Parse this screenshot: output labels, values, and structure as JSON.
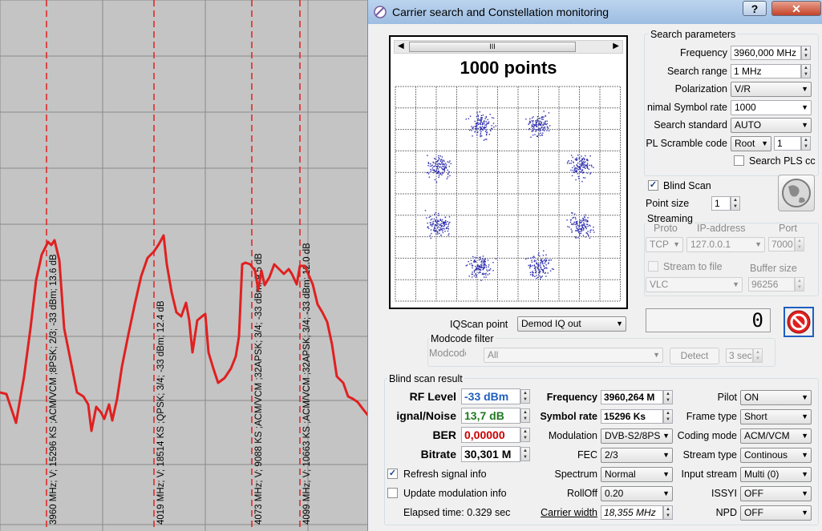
{
  "window": {
    "title": "Carrier search and Constellation monitoring",
    "help_label": "?",
    "close_label": "✕"
  },
  "spectrum": {
    "markers": [
      {
        "label": "3960 MHz; V; 15296 KS ;ACM/VCM ;8PSK; 2/3; -33 dBm; 13.6 dB"
      },
      {
        "label": "4019 MHz; V; 18514 KS ;QPSK; 3/4; -33 dBm; 12.4 dB"
      },
      {
        "label": "4073 MHz; V; 9088 KS ;ACM/VCM ;32APSK; 3/4; -33 dBm; 9.5 dB"
      },
      {
        "label": "4099 MHz; V; 10663 KS ;ACM/VCM ;32APSK; 3/4; -33 dBm; 12.0 dB"
      }
    ]
  },
  "constellation": {
    "title": "1000 points",
    "scroll_grip": "III",
    "point_count": 1000
  },
  "search": {
    "title": "Search parameters",
    "frequency_label": "Frequency",
    "frequency_value": "3960,000 MHz",
    "range_label": "Search range",
    "range_value": "1 MHz",
    "polarization_label": "Polarization",
    "polarization_value": "V/R",
    "min_sr_label": "nimal Symbol rate",
    "min_sr_value": "1000",
    "standard_label": "Search standard",
    "standard_value": "AUTO",
    "pls_label": "PL Scramble code",
    "pls_mode": "Root",
    "pls_value": "1",
    "search_pls_label": "Search PLS cc"
  },
  "blind_scan": {
    "label": "Blind Scan",
    "checked": "✓",
    "point_size_label": "Point size",
    "point_size_value": "1"
  },
  "streaming": {
    "title": "Streaming",
    "proto_label": "Proto",
    "ip_label": "IP-address",
    "port_label": "Port",
    "proto_value": "TCP",
    "ip_value": "127.0.0.1",
    "port_value": "7000",
    "stream_file_label": "Stream to file",
    "buffer_label": "Buffer size",
    "player_value": "VLC",
    "buffer_value": "96256"
  },
  "counter": {
    "value": "0"
  },
  "iqscan": {
    "label": "IQScan point",
    "value": "Demod IQ out"
  },
  "modcode": {
    "title": "Modcode filter",
    "label": "Modcode",
    "value": "All",
    "detect_label": "Detect",
    "sec_value": "3 sec"
  },
  "result": {
    "title": "Blind scan result",
    "rf_label": "RF Level",
    "rf_value": "-33 dBm",
    "rf_color": "#1f5fbf",
    "snr_label": "ignal/Noise",
    "snr_value": "13,7 dB",
    "snr_color": "#1f7a1f",
    "ber_label": "BER",
    "ber_value": "0,00000",
    "ber_color": "#cc0000",
    "bitrate_label": "Bitrate",
    "bitrate_value": "30,301 M",
    "freq_label": "Frequency",
    "freq_value": "3960,264 M",
    "sr_label": "Symbol rate",
    "sr_value": "15296 Ks",
    "mod_label": "Modulation",
    "mod_value": "DVB-S2/8PS",
    "fec_label": "FEC",
    "fec_value": "2/3",
    "spectrum_label": "Spectrum",
    "spectrum_value": "Normal",
    "rolloff_label": "RollOff",
    "rolloff_value": "0.20",
    "carrier_width_label": "Carrier width",
    "carrier_width_value": "18,355 MHz",
    "pilot_label": "Pilot",
    "pilot_value": "ON",
    "frame_label": "Frame type",
    "frame_value": "Short",
    "coding_label": "Coding mode",
    "coding_value": "ACM/VCM",
    "stream_type_label": "Stream type",
    "stream_type_value": "Continous",
    "input_stream_label": "Input stream",
    "input_stream_value": "Multi (0)",
    "issyi_label": "ISSYI",
    "issyi_value": "OFF",
    "npd_label": "NPD",
    "npd_value": "OFF",
    "refresh_label": "Refresh signal info",
    "refresh_checked": "✓",
    "update_label": "Update modulation info",
    "elapsed_label": "Elapsed time: 0.329 sec"
  }
}
